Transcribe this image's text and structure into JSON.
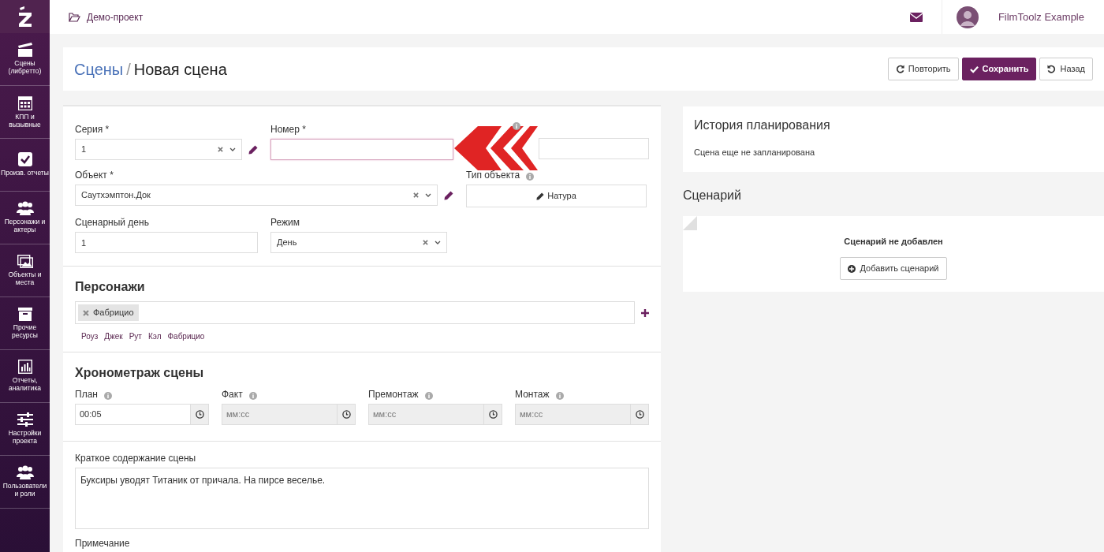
{
  "topbar": {
    "project": "Демо-проект",
    "user_name": "FilmToolz Example"
  },
  "sidebar": {
    "items": [
      {
        "label": "Сцены (либретто)"
      },
      {
        "label": "КПП и вызывные"
      },
      {
        "label": "Произв. отчеты"
      },
      {
        "label": "Персонажи и актеры"
      },
      {
        "label": "Объекты и места"
      },
      {
        "label": "Прочие ресурсы"
      },
      {
        "label": "Отчеты, аналитика"
      },
      {
        "label": "Настройки проекта"
      },
      {
        "label": "Пользователи и роли"
      }
    ]
  },
  "header": {
    "breadcrumb_parent": "Сцены",
    "separator": "/",
    "title": "Новая сцена",
    "buttons": [
      {
        "label": "Повторить",
        "kind": "repeat"
      },
      {
        "label": "Сохранить",
        "kind": "save"
      },
      {
        "label": "Назад",
        "kind": "back"
      }
    ]
  },
  "form": {
    "series": {
      "label": "Серия *",
      "value": "1"
    },
    "number": {
      "label": "Номер *",
      "focused": true
    },
    "prefix": {
      "info": true
    },
    "object": {
      "label": "Объект *",
      "value": "Саутхэмптон.Док"
    },
    "object_type": {
      "label": "Тип объекта",
      "info": true,
      "button": "Натура"
    },
    "script_day": {
      "label": "Сценарный день",
      "value": "1"
    },
    "mode": {
      "label": "Режим",
      "value": "День"
    }
  },
  "characters": {
    "title": "Персонажи",
    "tags": [
      "Фабрицио"
    ],
    "suggestions": [
      "Роуз",
      "Джек",
      "Рут",
      "Кэл",
      "Фабрицио"
    ]
  },
  "timing": {
    "title": "Хронометраж сцены",
    "fields": [
      {
        "label": "План",
        "value": "00:05",
        "disabled": false
      },
      {
        "label": "Факт",
        "placeholder": "мм:сс",
        "disabled": true
      },
      {
        "label": "Премонтаж",
        "placeholder": "мм:сс",
        "disabled": true
      },
      {
        "label": "Монтаж",
        "placeholder": "мм:сс",
        "disabled": true
      }
    ]
  },
  "summary": {
    "label": "Краткое содержание сцены",
    "value": "Буксиры уводят Титаник от причала. На пирсе веселье."
  },
  "note": {
    "label": "Примечание"
  },
  "history": {
    "title": "История планирования",
    "text": "Сцена еще не запланирована"
  },
  "script": {
    "title": "Сценарий",
    "empty_text": "Сценарий не добавлен",
    "button": "Добавить сценарий"
  }
}
